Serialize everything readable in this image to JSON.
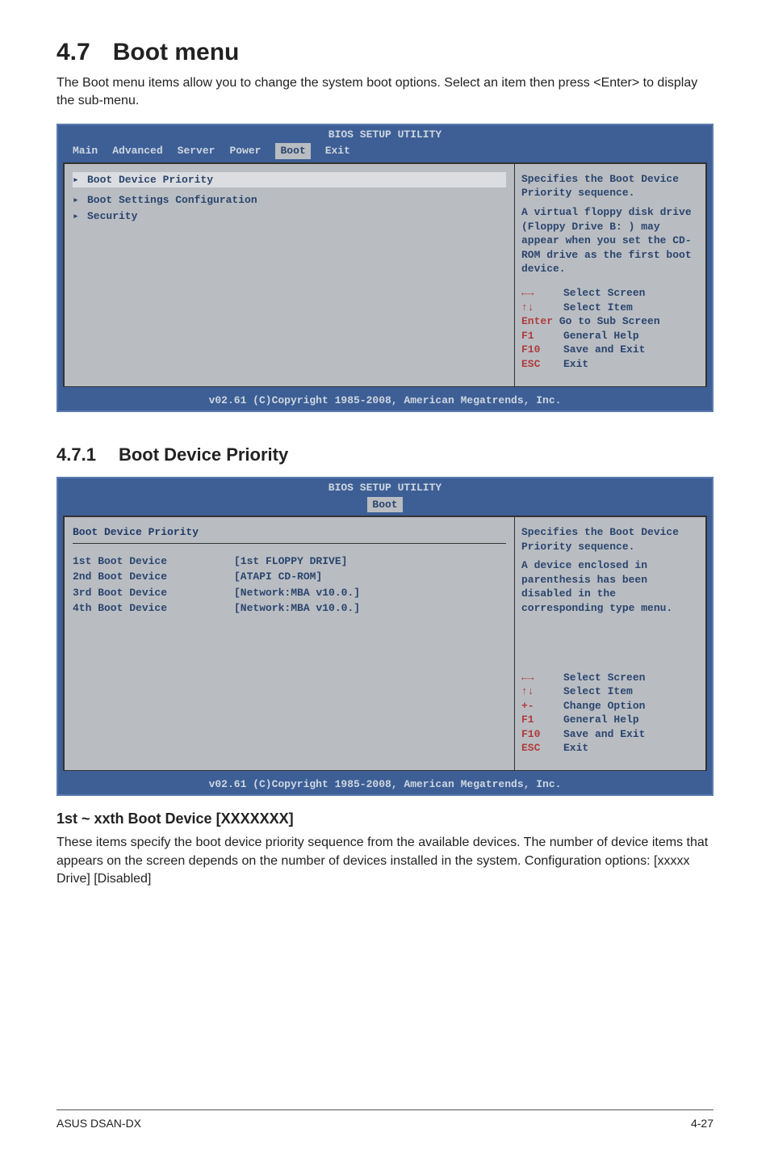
{
  "section1": {
    "number": "4.7",
    "title": "Boot menu",
    "intro": "The Boot menu items allow you to change the system boot options. Select an item then press <Enter> to display the sub-menu."
  },
  "bios1": {
    "title": "BIOS SETUP UTILITY",
    "tabs": {
      "main": "Main",
      "advanced": "Advanced",
      "server": "Server",
      "power": "Power",
      "boot": "Boot",
      "exit": "Exit"
    },
    "items": {
      "bdp": "Boot Device Priority",
      "bsc": "Boot Settings Configuration",
      "sec": "Security"
    },
    "help": {
      "l1": "Specifies the Boot Device Priority sequence.",
      "l2": "A virtual floppy disk drive (Floppy Drive B: ) may appear when you set the CD-ROM drive as the first boot device."
    },
    "keys": {
      "select_screen": "Select Screen",
      "select_item": "Select Item",
      "enter": "Enter Go to Sub Screen",
      "f1": "General Help",
      "f10": "Save and Exit",
      "esc": "Exit",
      "k_arrows": "←→",
      "k_ud": "↑↓",
      "k_f1": "F1",
      "k_f10": "F10",
      "k_esc": "ESC"
    },
    "copyright": "v02.61 (C)Copyright 1985-2008, American Megatrends, Inc."
  },
  "section2": {
    "number": "4.7.1",
    "title": "Boot Device Priority"
  },
  "bios2": {
    "title": "BIOS SETUP UTILITY",
    "tab_boot": "Boot",
    "head": "Boot Device Priority",
    "rows": {
      "r1l": "1st Boot Device",
      "r1v": "[1st FLOPPY DRIVE]",
      "r2l": "2nd Boot Device",
      "r2v": "[ATAPI CD-ROM]",
      "r3l": "3rd Boot Device",
      "r3v": "[Network:MBA v10.0.]",
      "r4l": "4th Boot Device",
      "r4v": "[Network:MBA v10.0.]"
    },
    "help": {
      "l1": "Specifies the Boot Device Priority sequence.",
      "l2": "A device enclosed in parenthesis has been disabled in the corresponding type menu."
    },
    "keys": {
      "select_screen": "Select Screen",
      "select_item": "Select Item",
      "change_option": "Change Option",
      "f1": "General Help",
      "f10": "Save and Exit",
      "esc": "Exit",
      "k_arrows": "←→",
      "k_ud": "↑↓",
      "k_pm": "+-",
      "k_f1": "F1",
      "k_f10": "F10",
      "k_esc": "ESC"
    },
    "copyright": "v02.61 (C)Copyright 1985-2008, American Megatrends, Inc."
  },
  "param": {
    "title": "1st ~ xxth Boot Device [XXXXXXX]",
    "body": "These items specify the boot device priority sequence from the available devices. The number of device items that appears on the screen depends on the number of devices installed in the system. Configuration options: [xxxxx Drive] [Disabled]"
  },
  "footer": {
    "left": "ASUS DSAN-DX",
    "right": "4-27"
  }
}
